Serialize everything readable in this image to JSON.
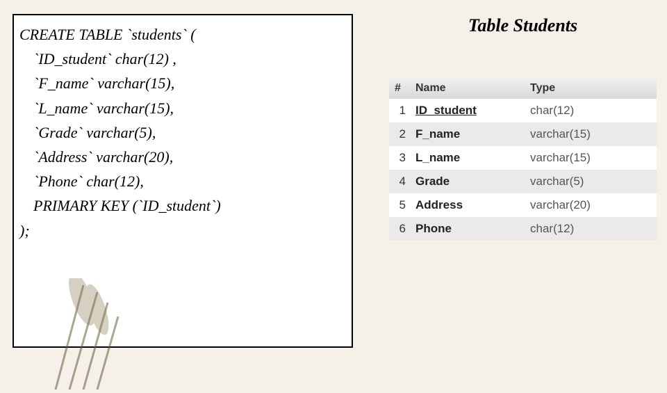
{
  "sql": {
    "line1": "CREATE TABLE `students` (",
    "line2": "`ID_student` char(12) ,",
    "line3": "`F_name` varchar(15),",
    "line4": "`L_name` varchar(15),",
    "line5": "`Grade` varchar(5),",
    "line6": "`Address` varchar(20),",
    "line7": "`Phone` char(12),",
    "line8": "PRIMARY KEY (`ID_student`)",
    "line9": ");"
  },
  "right": {
    "title": "Table Students",
    "headers": {
      "hash": "#",
      "name": "Name",
      "type": "Type"
    },
    "rows": [
      {
        "n": "1",
        "name": "ID_student",
        "type": "char(12)",
        "underline": true
      },
      {
        "n": "2",
        "name": "F_name",
        "type": "varchar(15)",
        "underline": false
      },
      {
        "n": "3",
        "name": "L_name",
        "type": "varchar(15)",
        "underline": false
      },
      {
        "n": "4",
        "name": "Grade",
        "type": "varchar(5)",
        "underline": false
      },
      {
        "n": "5",
        "name": "Address",
        "type": "varchar(20)",
        "underline": false
      },
      {
        "n": "6",
        "name": "Phone",
        "type": "char(12)",
        "underline": false
      }
    ]
  }
}
